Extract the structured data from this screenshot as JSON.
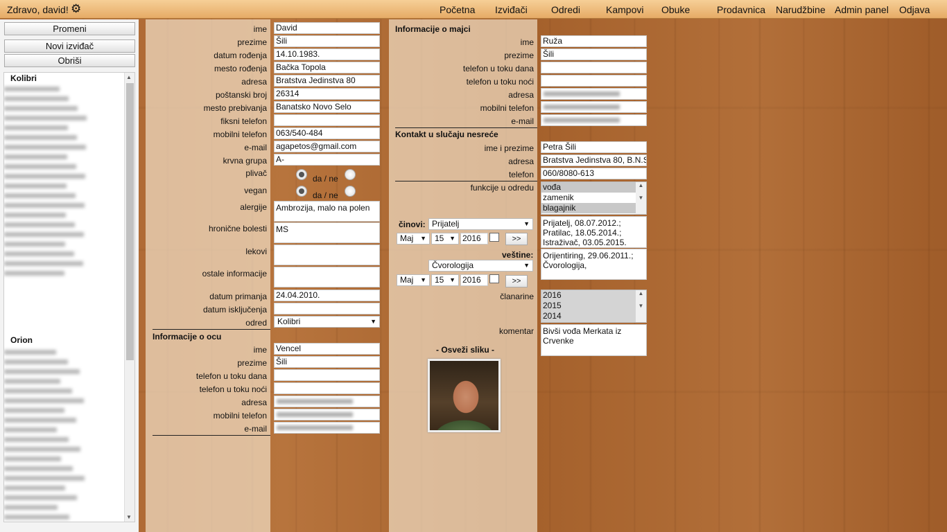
{
  "header": {
    "greeting": "Zdravo, david!",
    "nav": [
      "Početna",
      "Izviđači",
      "Odredi",
      "Kampovi",
      "Obuke",
      "Prodavnica",
      "Narudžbine",
      "Admin panel",
      "Odjava"
    ]
  },
  "sidebar": {
    "buttons": [
      "Promeni",
      "Novi izviđač",
      "Obriši"
    ],
    "groups": [
      "Kolibri",
      "Orion"
    ]
  },
  "form": {
    "ime": {
      "label": "ime",
      "value": "David"
    },
    "prezime": {
      "label": "prezime",
      "value": "Šili"
    },
    "datum_rodjenja": {
      "label": "datum rođenja",
      "value": "14.10.1983."
    },
    "mesto_rodjenja": {
      "label": "mesto rođenja",
      "value": "Bačka Topola"
    },
    "adresa": {
      "label": "adresa",
      "value": "Bratstva Jedinstva 80"
    },
    "postanski_broj": {
      "label": "poštanski broj",
      "value": "26314"
    },
    "mesto_prebivanja": {
      "label": "mesto prebivanja",
      "value": "Banatsko Novo Selo"
    },
    "fiksni_telefon": {
      "label": "fiksni telefon",
      "value": ""
    },
    "mobilni_telefon": {
      "label": "mobilni telefon",
      "value": "063/540-484"
    },
    "email": {
      "label": "e-mail",
      "value": "agapetos@gmail.com"
    },
    "krvna_grupa": {
      "label": "krvna grupa",
      "value": "A-"
    },
    "plivac": {
      "label": "plivač",
      "option": "da / ne"
    },
    "vegan": {
      "label": "vegan",
      "option": "da / ne"
    },
    "alergije": {
      "label": "alergije",
      "value": "Ambrozija, malo na polen"
    },
    "hronicne_bolesti": {
      "label": "hronične bolesti",
      "value": "MS"
    },
    "lekovi": {
      "label": "lekovi",
      "value": ""
    },
    "ostale_informacije": {
      "label": "ostale informacije",
      "value": ""
    },
    "datum_primanja": {
      "label": "datum primanja",
      "value": "24.04.2010."
    },
    "datum_iskljucenja": {
      "label": "datum isključenja",
      "value": ""
    },
    "odred": {
      "label": "odred",
      "value": "Kolibri"
    }
  },
  "otac": {
    "title": "Informacije o ocu",
    "ime": {
      "label": "ime",
      "value": "Vencel"
    },
    "prezime": {
      "label": "prezime",
      "value": "Šili"
    },
    "tel_dan": {
      "label": "telefon u toku dana",
      "value": ""
    },
    "tel_noc": {
      "label": "telefon u toku noći",
      "value": ""
    },
    "adresa": {
      "label": "adresa"
    },
    "mobilni": {
      "label": "mobilni telefon"
    },
    "email": {
      "label": "e-mail"
    }
  },
  "majka": {
    "title": "Informacije o majci",
    "ime": {
      "label": "ime",
      "value": "Ruža"
    },
    "prezime": {
      "label": "prezime",
      "value": "Šili"
    },
    "tel_dan": {
      "label": "telefon u toku dana",
      "value": ""
    },
    "tel_noc": {
      "label": "telefon u toku noći",
      "value": ""
    },
    "adresa": {
      "label": "adresa"
    },
    "mobilni": {
      "label": "mobilni telefon"
    },
    "email": {
      "label": "e-mail"
    }
  },
  "kontakt": {
    "title": "Kontakt u slučaju nesreće",
    "ime": {
      "label": "ime i prezime",
      "value": "Petra Šili"
    },
    "adresa": {
      "label": "adresa",
      "value": "Bratstva Jedinstva 80, B.N.S"
    },
    "telefon": {
      "label": "telefon",
      "value": "060/8080-613"
    }
  },
  "funkcije": {
    "label": "funkcije u odredu",
    "options": [
      "vođa",
      "zamenik",
      "blagajnik"
    ]
  },
  "cinovi": {
    "label": "činovi:",
    "select": "Prijatelj",
    "month": "Maj",
    "day": "15",
    "year": "2016",
    "add": ">>",
    "list": "Prijatelj, 08.07.2012.; Pratilac, 18.05.2014.; Istraživač, 03.05.2015."
  },
  "vestine": {
    "label": "veštine:",
    "select": "Čvorologija",
    "month": "Maj",
    "day": "15",
    "year": "2016",
    "add": ">>",
    "list": "Orijentiring, 29.06.2011.; Čvorologija,"
  },
  "clanarine": {
    "label": "članarine",
    "options": [
      "2016",
      "2015",
      "2014"
    ]
  },
  "komentar": {
    "label": "komentar",
    "value": "Bivši vođa Merkata iz Crvenke"
  },
  "photo": {
    "refresh": "- Osveži sliku -"
  }
}
